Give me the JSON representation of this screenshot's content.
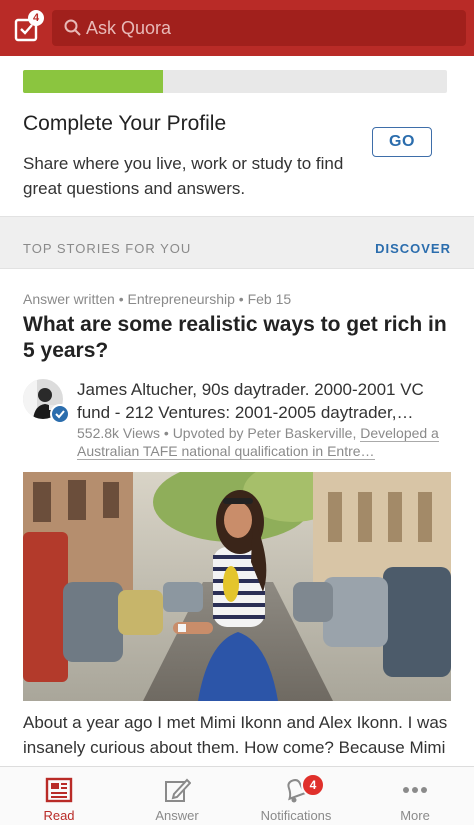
{
  "header": {
    "inbox_badge": "4",
    "search_placeholder": "Ask Quora",
    "brand_color": "#b92b27"
  },
  "profile_card": {
    "progress_fraction": 0.33,
    "title": "Complete Your Profile",
    "description": "Share where you live, work or study to find great questions and answers.",
    "go_label": "GO"
  },
  "section": {
    "title": "TOP STORIES FOR YOU",
    "link": "DISCOVER"
  },
  "story": {
    "meta": "Answer written • Entrepreneurship • Feb 15",
    "title": "What are some realistic ways to get rich in 5 years?",
    "author": "James Altucher, 90s daytrader. 2000-2001 VC fund - 212 Ventures: 2001-2005 daytrader,…",
    "views": "552.8k Views",
    "upvote_prefix": " • Upvoted by Peter Baskerville, ",
    "upvoter_credential": "Developed a Australian TAFE national qualification in Entre…",
    "body": "About a year ago I met Mimi Ikonn and Alex Ikonn. I was insanely curious about them. How come? Because Mimi makes videos of herself, delivers real"
  },
  "bottom_nav": {
    "items": [
      {
        "label": "Read",
        "icon": "read-icon",
        "active": true
      },
      {
        "label": "Answer",
        "icon": "answer-icon",
        "active": false
      },
      {
        "label": "Notifications",
        "icon": "notifications-icon",
        "active": false,
        "badge": "4"
      },
      {
        "label": "More",
        "icon": "more-icon",
        "active": false
      }
    ]
  }
}
